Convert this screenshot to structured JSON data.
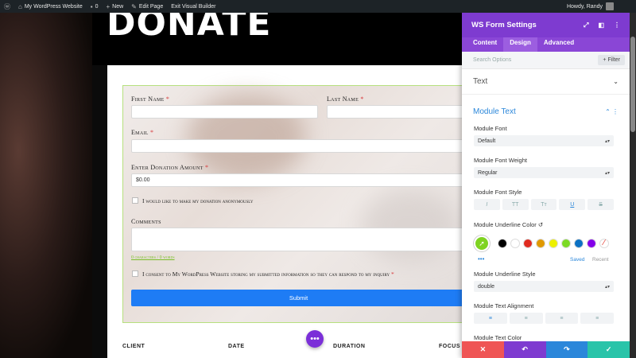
{
  "adminbar": {
    "site_name": "My WordPress Website",
    "comments": "0",
    "new_label": "New",
    "edit_page": "Edit Page",
    "exit_builder": "Exit Visual Builder",
    "howdy": "Howdy, Randy"
  },
  "page": {
    "title": "DONATE"
  },
  "form": {
    "first_name": "First Name",
    "last_name": "Last Name",
    "email": "Email",
    "amount_label": "Enter Donation Amount",
    "amount_value": "$0.00",
    "anon_label": "I would like to make my donation anonymously",
    "comments_label": "Comments",
    "counter": "0 characters / 0 words",
    "consent_label": "I consent to My WordPress Website storing my submitted information so they can respond to my inquiry",
    "required_mark": "*",
    "submit": "Submit"
  },
  "table_headers": [
    "CLIENT",
    "DATE",
    "DURATION",
    "FOCUS"
  ],
  "float_button": "•••",
  "panel": {
    "title": "WS Form Settings",
    "tabs": [
      "Content",
      "Design",
      "Advanced"
    ],
    "active_tab": "Design",
    "search_placeholder": "Search Options",
    "filter": "+ Filter",
    "section_text": "Text",
    "section_module_text": "Module Text",
    "module_font_label": "Module Font",
    "module_font_value": "Default",
    "weight_label": "Module Font Weight",
    "weight_value": "Regular",
    "style_label": "Module Font Style",
    "style_buttons": [
      "I",
      "TT",
      "Tт",
      "U",
      "S"
    ],
    "underline_color_label": "Module Underline Color",
    "swatches": [
      "#000000",
      "#ffffff",
      "#e02b20",
      "#e09900",
      "#edf000",
      "#7cda24",
      "#0c71c3",
      "#8300e9"
    ],
    "saved": "Saved",
    "recent": "Recent",
    "underline_style_label": "Module Underline Style",
    "underline_style_value": "double",
    "alignment_label": "Module Text Alignment",
    "alignment_buttons": [
      "≡",
      "≡",
      "≡",
      "≡"
    ],
    "text_color_label": "Module Text Color",
    "footer_colors": [
      "#ef5555",
      "#7e3bd0",
      "#2b87da",
      "#29c4a9"
    ]
  }
}
